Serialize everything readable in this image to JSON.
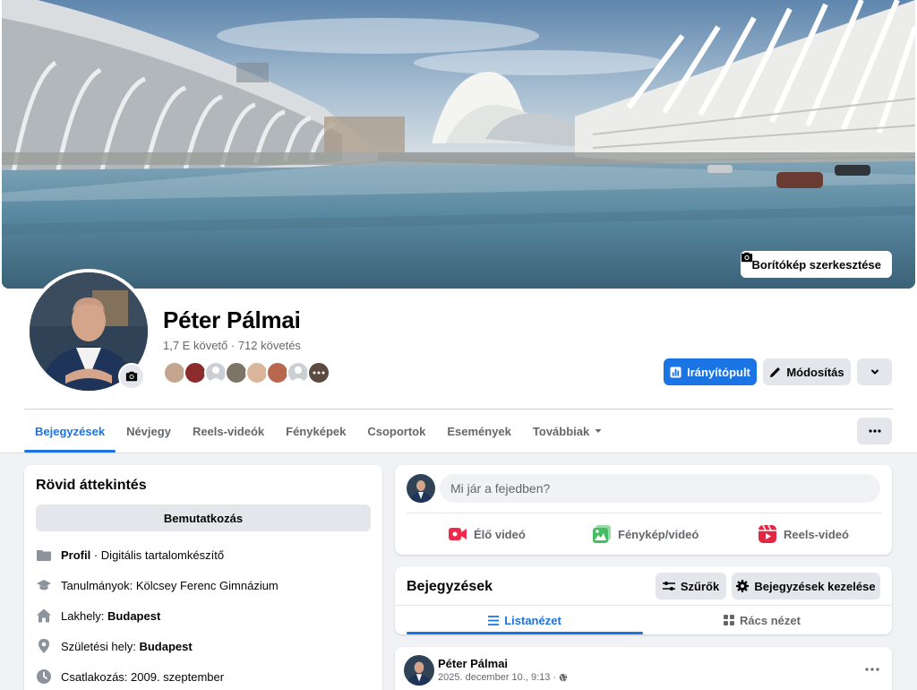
{
  "cover": {
    "edit_label": "Borítókép szerkesztése"
  },
  "profile": {
    "name": "Péter Pálmai",
    "stats": "1,7 E követő · 712 követés"
  },
  "actions": {
    "dashboard_label": "Irányítópult",
    "edit_label": "Módosítás"
  },
  "tabs": [
    {
      "label": "Bejegyzések",
      "active": true
    },
    {
      "label": "Névjegy"
    },
    {
      "label": "Reels-videók"
    },
    {
      "label": "Fényképek"
    },
    {
      "label": "Csoportok"
    },
    {
      "label": "Események"
    },
    {
      "label": "Továbbiak"
    }
  ],
  "intro": {
    "title": "Rövid áttekintés",
    "button_label": "Bemutatkozás",
    "profile_label": "Profil",
    "profile_value": " · Digitális tartalomkészítő",
    "studies": "Tanulmányok: Kölcsey Ferenc Gimnázium",
    "residence_label": "Lakhely: ",
    "residence_value": "Budapest",
    "birthplace_label": "Születési hely: ",
    "birthplace_value": "Budapest",
    "joined": "Csatlakozás: 2009. szeptember"
  },
  "composer": {
    "placeholder": "Mi jár a fejedben?",
    "live_label": "Élő videó",
    "photo_label": "Fénykép/videó",
    "reels_label": "Reels-videó"
  },
  "posts_section": {
    "title": "Bejegyzések",
    "filters_label": "Szűrők",
    "manage_label": "Bejegyzések kezelése",
    "list_view_label": "Listanézet",
    "grid_view_label": "Rács nézet"
  },
  "post": {
    "author": "Péter Pálmai",
    "date": "2025. december 10., 9:13 ·"
  },
  "colors": {
    "accent": "#1b74e4",
    "live_icon": "#f02849",
    "photo_icon": "#45bd62",
    "reels_icon": "#e42645"
  }
}
